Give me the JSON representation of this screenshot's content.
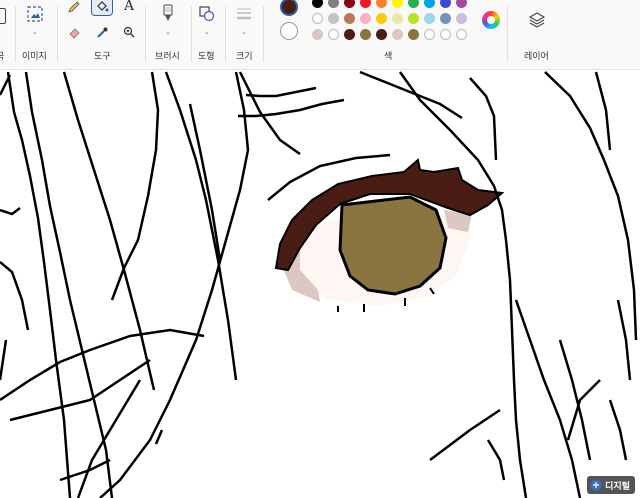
{
  "ribbon": {
    "groups": {
      "image": "이미지",
      "tools": "도구",
      "brushes": "브러시",
      "shapes": "도형",
      "size": "크기",
      "colors": "색",
      "layers": "레이어"
    },
    "left_clip": "곡",
    "text_tool_glyph": "A"
  },
  "colors": {
    "primary": "#4a1d14",
    "secondary": "#ffffff",
    "accent": "#2f5fa8",
    "row1": [
      "#000000",
      "#7f7f7f",
      "#880015",
      "#ed1c24",
      "#ff7f27",
      "#fff200",
      "#22b14c",
      "#00a2e8",
      "#3f48cc",
      "#a349a4"
    ],
    "row2": [
      "#ffffff",
      "#c3c3c3",
      "#b97a57",
      "#ffaec9",
      "#ffc90e",
      "#efe4b0",
      "#b5e61d",
      "#99d9ea",
      "#7092be",
      "#c8bfe7"
    ],
    "row3": [
      "#d9c8c2",
      "#ffffff",
      "#4a1d14",
      "#8a7540",
      "#4a1d14",
      "#dcc7c2",
      "#8a7540",
      "#ffffff",
      "#ffffff",
      "#ffffff"
    ]
  },
  "canvas": {
    "iris_color": "#8a7540",
    "lash_color": "#4a1d14",
    "shadow_color": "#dcc7c2",
    "skin_color": "#fdf6f3"
  },
  "watermark": {
    "text": "디지털"
  }
}
